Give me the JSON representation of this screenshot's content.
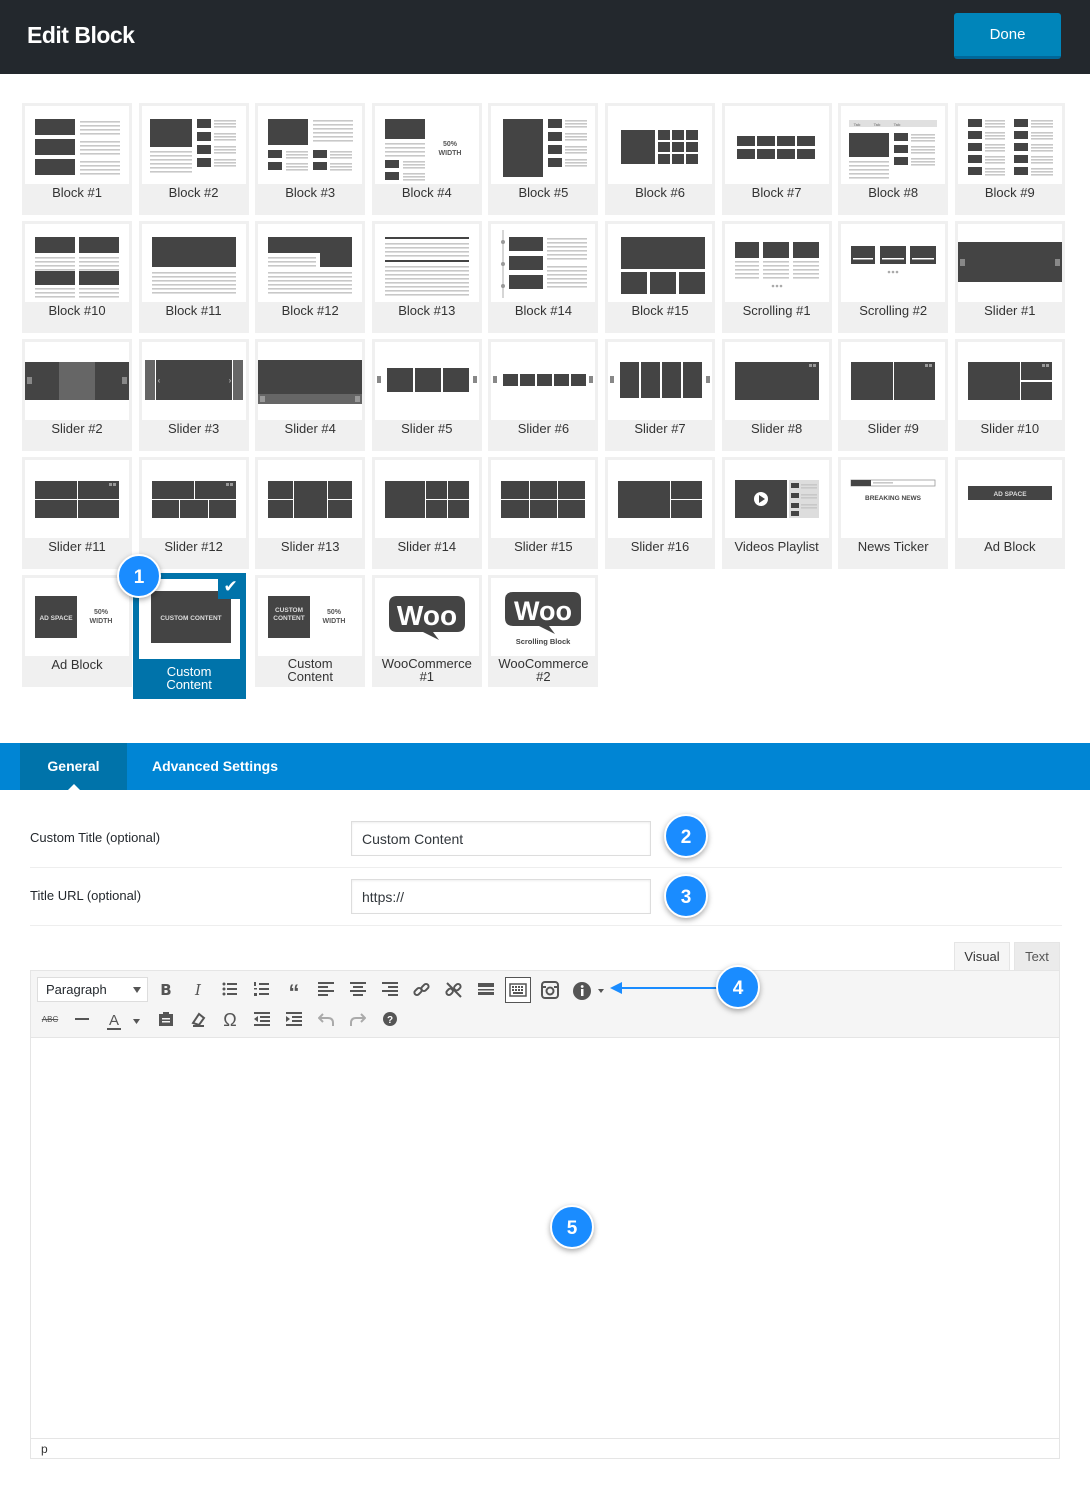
{
  "header": {
    "title": "Edit Block",
    "done_label": "Done"
  },
  "tiles": [
    {
      "label": "Block #1",
      "icon": "block-1-thumbnail"
    },
    {
      "label": "Block #2",
      "icon": "block-2-thumbnail"
    },
    {
      "label": "Block #3",
      "icon": "block-3-thumbnail"
    },
    {
      "label": "Block #4",
      "icon": "block-4-thumbnail",
      "thumb_text": "50%\nWIDTH"
    },
    {
      "label": "Block #5",
      "icon": "block-5-thumbnail"
    },
    {
      "label": "Block #6",
      "icon": "block-6-thumbnail"
    },
    {
      "label": "Block #7",
      "icon": "block-7-thumbnail"
    },
    {
      "label": "Block #8",
      "icon": "block-8-thumbnail"
    },
    {
      "label": "Block #9",
      "icon": "block-9-thumbnail"
    },
    {
      "label": "Block #10",
      "icon": "block-10-thumbnail"
    },
    {
      "label": "Block #11",
      "icon": "block-11-thumbnail"
    },
    {
      "label": "Block #12",
      "icon": "block-12-thumbnail"
    },
    {
      "label": "Block #13",
      "icon": "block-13-thumbnail"
    },
    {
      "label": "Block #14",
      "icon": "block-14-thumbnail"
    },
    {
      "label": "Block #15",
      "icon": "block-15-thumbnail"
    },
    {
      "label": "Scrolling #1",
      "icon": "scrolling-1-thumbnail"
    },
    {
      "label": "Scrolling #2",
      "icon": "scrolling-2-thumbnail"
    },
    {
      "label": "Slider #1",
      "icon": "slider-1-thumbnail"
    },
    {
      "label": "Slider #2",
      "icon": "slider-2-thumbnail"
    },
    {
      "label": "Slider #3",
      "icon": "slider-3-thumbnail"
    },
    {
      "label": "Slider #4",
      "icon": "slider-4-thumbnail"
    },
    {
      "label": "Slider #5",
      "icon": "slider-5-thumbnail"
    },
    {
      "label": "Slider #6",
      "icon": "slider-6-thumbnail"
    },
    {
      "label": "Slider #7",
      "icon": "slider-7-thumbnail"
    },
    {
      "label": "Slider #8",
      "icon": "slider-8-thumbnail"
    },
    {
      "label": "Slider #9",
      "icon": "slider-9-thumbnail"
    },
    {
      "label": "Slider #10",
      "icon": "slider-10-thumbnail"
    },
    {
      "label": "Slider #11",
      "icon": "slider-11-thumbnail"
    },
    {
      "label": "Slider #12",
      "icon": "slider-12-thumbnail"
    },
    {
      "label": "Slider #13",
      "icon": "slider-13-thumbnail"
    },
    {
      "label": "Slider #14",
      "icon": "slider-14-thumbnail"
    },
    {
      "label": "Slider #15",
      "icon": "slider-15-thumbnail"
    },
    {
      "label": "Slider #16",
      "icon": "slider-16-thumbnail"
    },
    {
      "label": "Videos Playlist",
      "icon": "videos-playlist-thumbnail"
    },
    {
      "label": "News Ticker",
      "icon": "news-ticker-thumbnail",
      "thumb_text": "BREAKING NEWS"
    },
    {
      "label": "Ad Block",
      "icon": "ad-block-thumbnail",
      "thumb_text": "AD SPACE"
    },
    {
      "label": "Ad Block",
      "icon": "ad-block-half-thumbnail",
      "thumb_text": "AD SPACE",
      "thumb_text2": "50%\nWIDTH"
    },
    {
      "label": "Custom\nContent",
      "icon": "custom-content-thumbnail",
      "thumb_text": "CUSTOM CONTENT",
      "selected": true
    },
    {
      "label": "Custom\nContent",
      "icon": "custom-content-half-thumbnail",
      "thumb_text": "CUSTOM\nCONTENT",
      "thumb_text2": "50%\nWIDTH"
    },
    {
      "label": "WooCommerce\n#1",
      "icon": "woocommerce-logo",
      "thumb_text": "Woo"
    },
    {
      "label": "WooCommerce\n#2",
      "icon": "woocommerce-scrolling-logo",
      "thumb_text": "Woo",
      "thumb_text2": "Scrolling Block"
    }
  ],
  "badges": [
    "1",
    "2",
    "3",
    "4",
    "5"
  ],
  "tabs": {
    "general": "General",
    "advanced": "Advanced Settings"
  },
  "fields": {
    "custom_title_label": "Custom Title (optional)",
    "custom_title_value": "Custom Content",
    "title_url_label": "Title URL (optional)",
    "title_url_value": "https://"
  },
  "editor": {
    "visual_tab": "Visual",
    "text_tab": "Text",
    "format": "Paragraph",
    "status_path": "p"
  },
  "colors": {
    "header_bg": "#23282d",
    "accent": "#0073aa",
    "tabbar": "#0085d4",
    "badge": "#1a8cff"
  }
}
